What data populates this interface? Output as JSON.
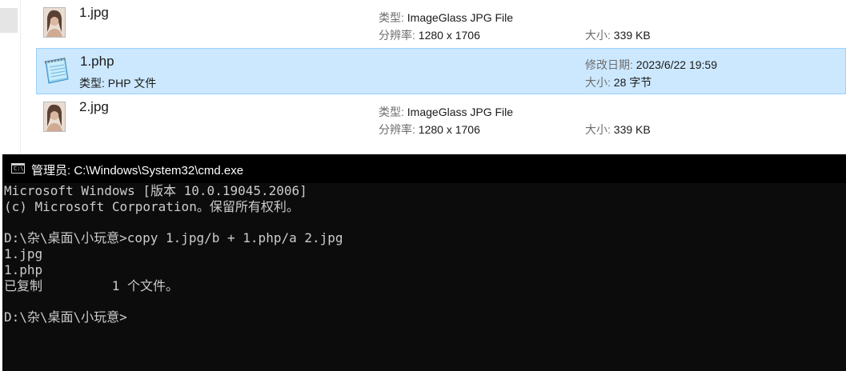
{
  "files": [
    {
      "name": "1.jpg",
      "icon": "photo-thumbnail-icon",
      "type_label": "类型:",
      "type_value": "ImageGlass JPG File",
      "res_label": "分辨率:",
      "res_value": "1280 x 1706",
      "size_label": "大小:",
      "size_value": "339 KB"
    },
    {
      "name": "1.php",
      "icon": "notepad-file-icon",
      "sub": "类型: PHP 文件",
      "date_label": "修改日期:",
      "date_value": "2023/6/22 19:59",
      "size_label": "大小:",
      "size_value": "28 字节"
    },
    {
      "name": "2.jpg",
      "icon": "photo-thumbnail-icon",
      "type_label": "类型:",
      "type_value": "ImageGlass JPG File",
      "res_label": "分辨率:",
      "res_value": "1280 x 1706",
      "size_label": "大小:",
      "size_value": "339 KB"
    }
  ],
  "cmd": {
    "icon": "cmd-icon",
    "title": "管理员: C:\\Windows\\System32\\cmd.exe",
    "lines": [
      "Microsoft Windows [版本 10.0.19045.2006]",
      "(c) Microsoft Corporation。保留所有权利。",
      "",
      "D:\\杂\\桌面\\小玩意>copy 1.jpg/b + 1.php/a 2.jpg",
      "1.jpg",
      "1.php",
      "已复制         1 个文件。",
      "",
      "D:\\杂\\桌面\\小玩意>"
    ]
  },
  "colors": {
    "selected_bg": "#cce8ff",
    "selected_border": "#99d1ff",
    "console_bg": "#0c0c0c",
    "console_fg": "#cccccc"
  }
}
